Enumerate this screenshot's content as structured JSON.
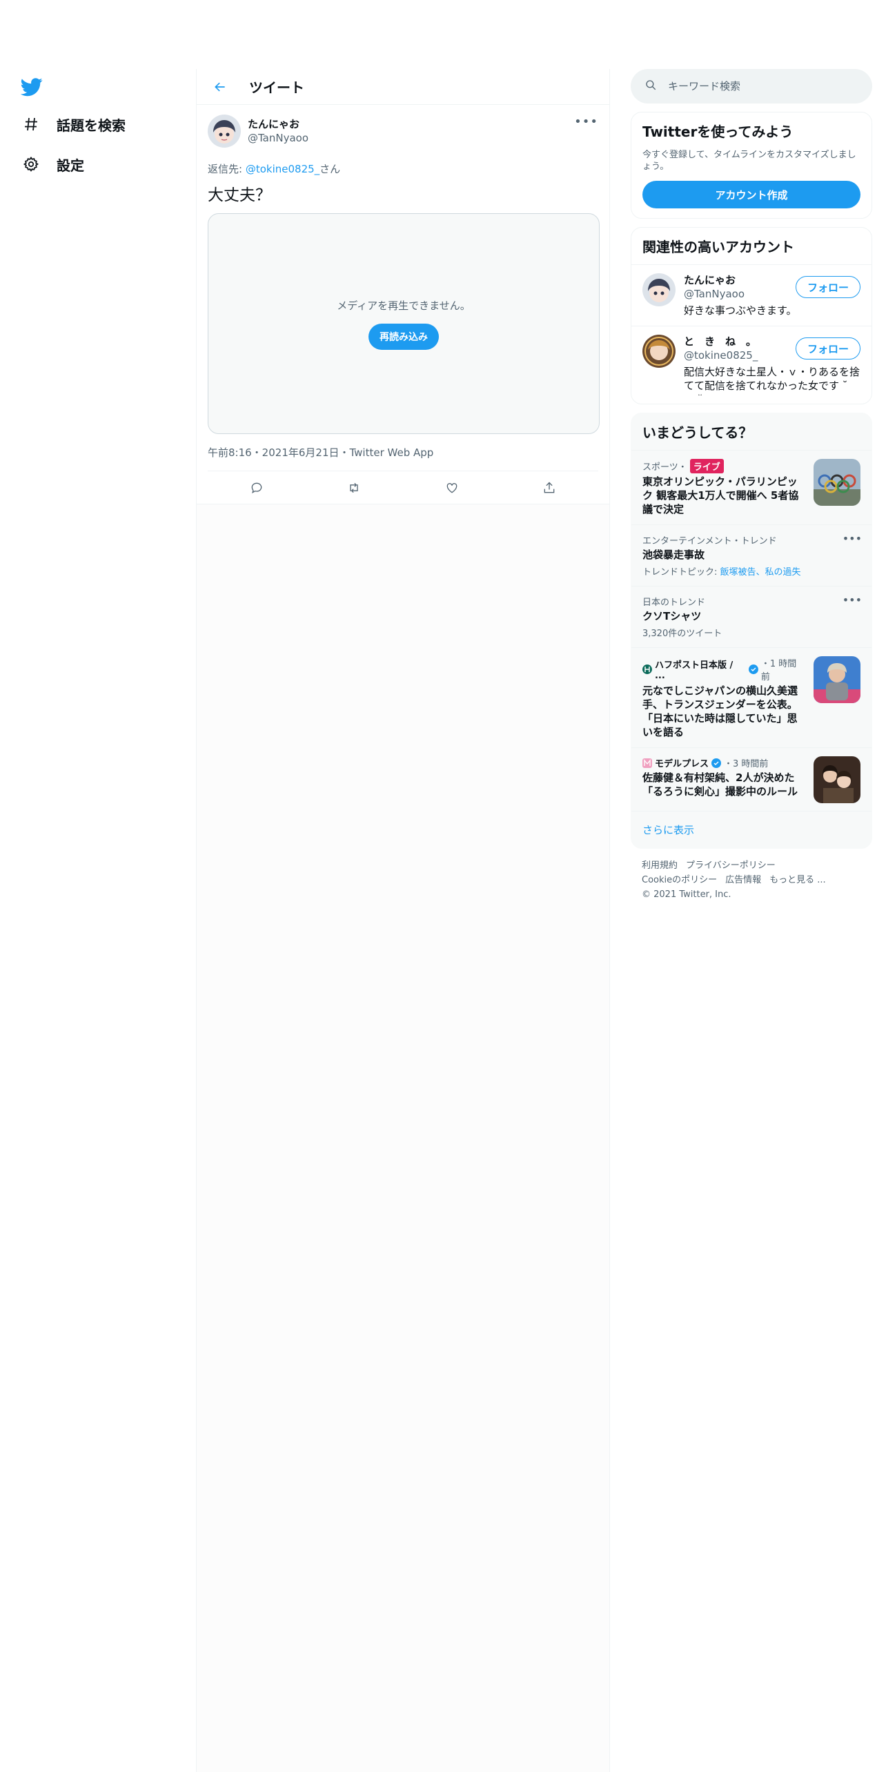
{
  "nav": {
    "items": [
      {
        "label": "話題を検索",
        "icon": "hashtag-icon"
      },
      {
        "label": "設定",
        "icon": "gear-icon"
      }
    ]
  },
  "header": {
    "title": "ツイート"
  },
  "tweet": {
    "author_name": "たんにゃお",
    "author_handle": "@TanNyaoo",
    "reply_prefix": "返信先: ",
    "reply_mention": "@tokine0825_",
    "reply_suffix": "さん",
    "text": "大丈夫？",
    "media_message": "メディアを再生できません。",
    "reload_label": "再読み込み",
    "meta": "午前8:16・2021年6月21日・Twitter Web App"
  },
  "search": {
    "placeholder": "キーワード検索"
  },
  "signup": {
    "title": "Twitterを使ってみよう",
    "desc": "今すぐ登録して、タイムラインをカスタマイズしましょう。",
    "button": "アカウント作成"
  },
  "related": {
    "title": "関連性の高いアカウント",
    "accounts": [
      {
        "name": "たんにゃお",
        "handle": "@TanNyaoo",
        "bio": "好きな事つぶやきます。",
        "follow": "フォロー"
      },
      {
        "name": "と　き　ね　。",
        "handle": "@tokine0825_",
        "bio": "配信大好きな土星人・ｖ・りあるを捨てて配信を捨てれなかった女です ˘ ｖ ˘",
        "follow": "フォロー"
      }
    ]
  },
  "trends": {
    "title": "いまどうしてる？",
    "items": [
      {
        "context": "スポーツ・",
        "live": "ライブ",
        "title": "東京オリンピック・パラリンピック 観客最大1万人で開催へ 5者協議で決定"
      },
      {
        "context": "エンターテインメント・トレンド",
        "title": "池袋暴走事故",
        "sub_prefix": "トレンドトピック: ",
        "sub_link": "飯塚被告、私の過失"
      },
      {
        "context": "日本のトレンド",
        "title": "クソTシャツ",
        "sub": "3,320件のツイート"
      },
      {
        "source": "ハフポスト日本版 / ...",
        "time": "・1 時間前",
        "title": "元なでしこジャパンの横山久美選手、トランスジェンダーを公表。「日本にいた時は隠していた」思いを語る"
      },
      {
        "source": "モデルプレス",
        "time": "・3 時間前",
        "title": "佐藤健＆有村架純、2人が決めた「るろうに剣心」撮影中のルール"
      }
    ],
    "show_more": "さらに表示"
  },
  "footer": {
    "links": [
      "利用規約",
      "プライバシーポリシー",
      "Cookieのポリシー",
      "広告情報",
      "もっと見る ..."
    ],
    "copyright": "© 2021 Twitter, Inc."
  },
  "colors": {
    "accent": "#1d9bf0",
    "live": "#e0245e",
    "text": "#0f1419",
    "secondary": "#536471"
  }
}
